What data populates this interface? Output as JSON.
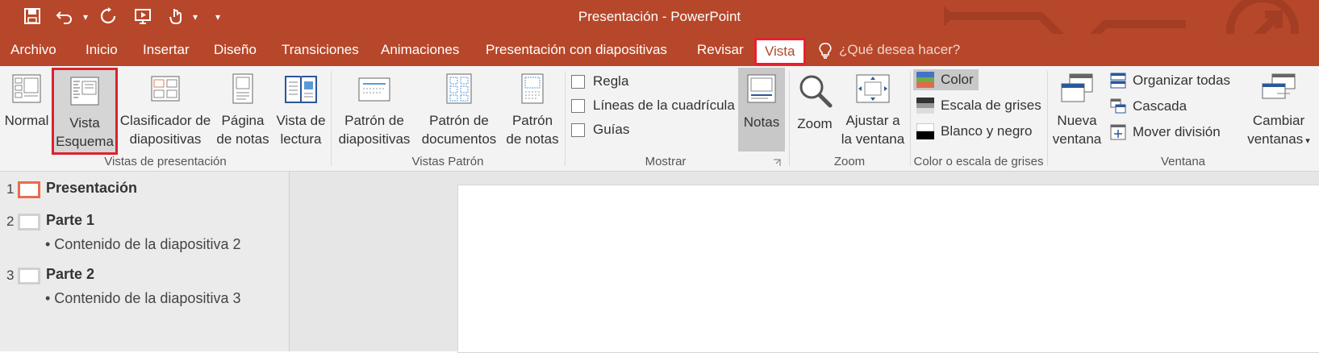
{
  "window": {
    "title": "Presentación - PowerPoint"
  },
  "quick_access": [
    {
      "name": "save-icon",
      "glyph": "💾"
    },
    {
      "name": "undo-icon",
      "glyph": "↶"
    },
    {
      "name": "redo-icon",
      "glyph": "↻"
    },
    {
      "name": "present-icon",
      "glyph": "▶"
    },
    {
      "name": "touch-mode-icon",
      "glyph": "☝"
    },
    {
      "name": "customize-qat-icon",
      "glyph": "▾"
    }
  ],
  "tabs": [
    {
      "label": "Archivo"
    },
    {
      "label": "Inicio"
    },
    {
      "label": "Insertar"
    },
    {
      "label": "Diseño"
    },
    {
      "label": "Transiciones"
    },
    {
      "label": "Animaciones"
    },
    {
      "label": "Presentación con diapositivas"
    },
    {
      "label": "Revisar"
    },
    {
      "label": "Vista",
      "active": true
    }
  ],
  "tell_me": "¿Qué desea hacer?",
  "ribbon": {
    "presentation_views": {
      "label": "Vistas de presentación",
      "normal": "Normal",
      "outline_1": "Vista",
      "outline_2": "Esquema",
      "sorter_1": "Clasificador de",
      "sorter_2": "diapositivas",
      "notes_page_1": "Página",
      "notes_page_2": "de notas",
      "reading_1": "Vista de",
      "reading_2": "lectura"
    },
    "master_views": {
      "label": "Vistas Patrón",
      "slide_master_1": "Patrón de",
      "slide_master_2": "diapositivas",
      "handout_master_1": "Patrón de",
      "handout_master_2": "documentos",
      "notes_master_1": "Patrón",
      "notes_master_2": "de notas"
    },
    "show": {
      "label": "Mostrar",
      "ruler": "Regla",
      "gridlines": "Líneas de la cuadrícula",
      "guides": "Guías",
      "notes": "Notas"
    },
    "zoom": {
      "label": "Zoom",
      "zoom": "Zoom",
      "fit_1": "Ajustar a",
      "fit_2": "la ventana"
    },
    "color": {
      "label": "Color o escala de grises",
      "color": "Color",
      "grayscale": "Escala de grises",
      "bw": "Blanco y negro"
    },
    "window": {
      "label": "Ventana",
      "new_1": "Nueva",
      "new_2": "ventana",
      "arrange": "Organizar todas",
      "cascade": "Cascada",
      "split": "Mover división",
      "switch_1": "Cambiar",
      "switch_2": "ventanas"
    }
  },
  "outline": [
    {
      "num": "1",
      "title": "Presentación",
      "bullet": ""
    },
    {
      "num": "2",
      "title": "Parte 1",
      "bullet": "• Contenido de la diapositiva 2"
    },
    {
      "num": "3",
      "title": "Parte 2",
      "bullet": "• Contenido de la diapositiva 3"
    }
  ],
  "colors": {
    "accent": "#b7472a",
    "highlight": "#e8202d"
  }
}
